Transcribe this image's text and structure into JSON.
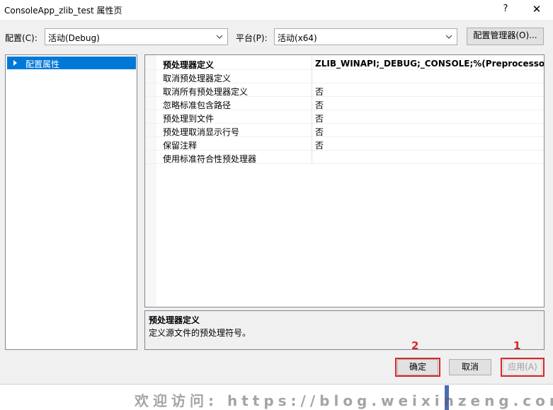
{
  "window": {
    "title": "ConsoleApp_zlib_test 属性页",
    "help_glyph": "?",
    "close_glyph": "✕"
  },
  "config": {
    "label": "配置(C):",
    "value": "活动(Debug)"
  },
  "platform": {
    "label": "平台(P):",
    "value": "活动(x64)"
  },
  "config_manager_label": "配置管理器(O)...",
  "tree": {
    "items": [
      {
        "label": "配置属性"
      }
    ]
  },
  "properties": [
    {
      "name": "预处理器定义",
      "value": "ZLIB_WINAPI;_DEBUG;_CONSOLE;%(PreprocessorDefi"
    },
    {
      "name": "取消预处理器定义",
      "value": ""
    },
    {
      "name": "取消所有预处理器定义",
      "value": "否"
    },
    {
      "name": "忽略标准包含路径",
      "value": "否"
    },
    {
      "name": "预处理到文件",
      "value": "否"
    },
    {
      "name": "预处理取消显示行号",
      "value": "否"
    },
    {
      "name": "保留注释",
      "value": "否"
    },
    {
      "name": "使用标准符合性预处理器",
      "value": ""
    }
  ],
  "description": {
    "title": "预处理器定义",
    "text": "定义源文件的预处理符号。"
  },
  "buttons": {
    "ok": "确定",
    "cancel": "取消",
    "apply": "应用(A)"
  },
  "annotations": {
    "ok_number": "2",
    "apply_number": "1",
    "color": "#d9262c"
  },
  "watermark": "欢迎访问: https://blog.weixinzeng.com"
}
